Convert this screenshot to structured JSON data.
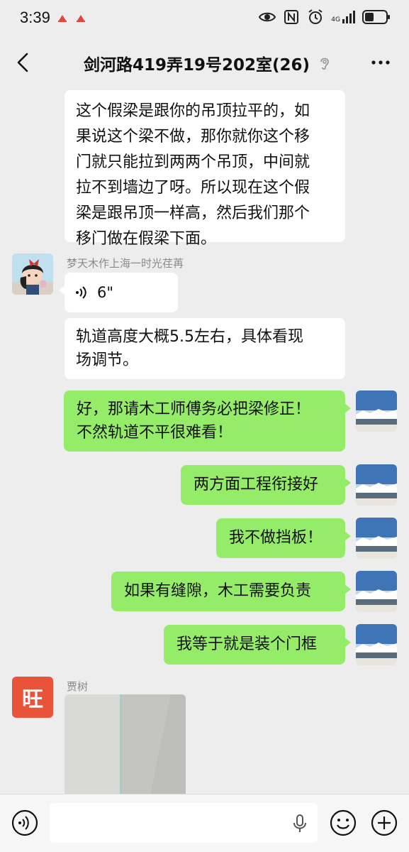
{
  "status_bar": {
    "time": "3:39",
    "network": "4G"
  },
  "header": {
    "title": "剑河路419弄19号202室(26)",
    "back_icon": "chevron-left-icon",
    "mute_icon": "ear-icon",
    "more_icon": "more-dots-icon"
  },
  "messages": [
    {
      "side": "left",
      "lines": [
        "这个假梁是跟你的吊顶拉平的，如",
        "果说这个梁不做，那你就你这个移",
        "门就只能拉到两两个吊顶，中间就",
        "拉不到墙边了呀。所以现在这个假",
        "梁是跟吊顶一样高，然后我们那个",
        "移门做在假梁下面。"
      ]
    },
    {
      "side": "left",
      "sender": "梦天木作上海一时光荏苒",
      "type": "voice",
      "duration": "6\""
    },
    {
      "side": "left",
      "lines": [
        "轨道高度大概5.5左右，具体看现",
        "场调节。"
      ]
    },
    {
      "side": "right",
      "lines": [
        "好，那请木工师傅务必把梁修正！",
        "不然轨道不平很难看！"
      ]
    },
    {
      "side": "right",
      "lines": [
        "两方面工程衔接好"
      ]
    },
    {
      "side": "right",
      "lines": [
        "我不做挡板！"
      ]
    },
    {
      "side": "right",
      "lines": [
        "如果有缝隙，木工需要负责"
      ]
    },
    {
      "side": "right",
      "lines": [
        "我等于就是装个门框"
      ]
    },
    {
      "side": "left",
      "sender": "贾树",
      "avatar_text": "旺",
      "type": "image"
    }
  ],
  "input_bar": {
    "voice_icon": "voice-mode-icon",
    "mic_icon": "microphone-icon",
    "emoji_icon": "emoji-icon",
    "plus_icon": "plus-icon"
  },
  "colors": {
    "background": "#ededed",
    "bubble_self": "#95ec69",
    "bubble_other": "#ffffff",
    "avatar_wang": "#e8533a"
  }
}
